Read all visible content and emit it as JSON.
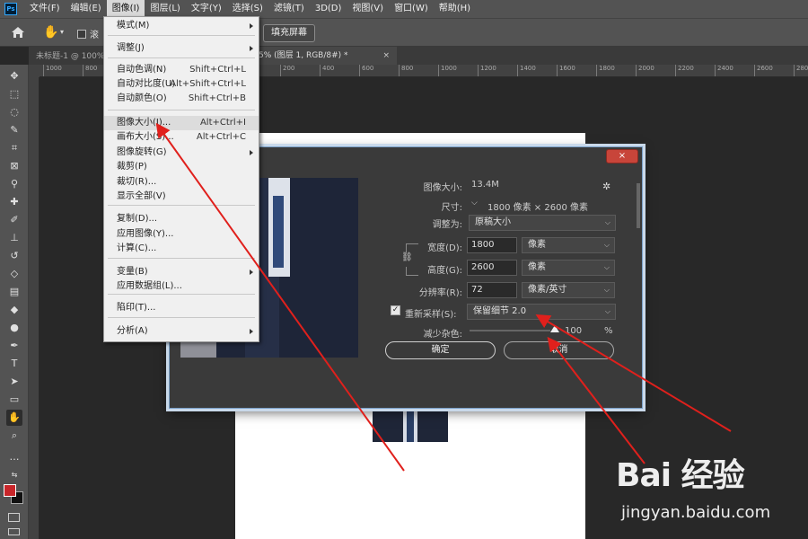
{
  "app": {
    "logo": "Ps"
  },
  "menubar": [
    {
      "label": "文件(F)"
    },
    {
      "label": "编辑(E)"
    },
    {
      "label": "图像(I)"
    },
    {
      "label": "图层(L)"
    },
    {
      "label": "文字(Y)"
    },
    {
      "label": "选择(S)"
    },
    {
      "label": "滤镜(T)"
    },
    {
      "label": "3D(D)"
    },
    {
      "label": "视图(V)"
    },
    {
      "label": "窗口(W)"
    },
    {
      "label": "帮助(H)"
    }
  ],
  "optbar": {
    "check_label": "滚",
    "fill_screen": "填充屏幕"
  },
  "tabs": {
    "doc1": "未标题-1 @ 100%",
    "doc2": "5% (图层 1, RGB/8#) *",
    "close": "×"
  },
  "ruler": [
    "1000",
    "800",
    "600",
    "400",
    "200",
    "0",
    "200",
    "400",
    "600",
    "800",
    "1000",
    "1200",
    "1400",
    "1600",
    "1800",
    "2000",
    "2200",
    "2400",
    "2600",
    "2800"
  ],
  "image_menu": {
    "items": [
      {
        "label": "模式(M)",
        "shortcut": "",
        "submenu": true
      },
      {
        "label": "调整(J)",
        "shortcut": "",
        "submenu": true
      },
      {
        "label": "自动色调(N)",
        "shortcut": "Shift+Ctrl+L",
        "submenu": false
      },
      {
        "label": "自动对比度(U)",
        "shortcut": "Alt+Shift+Ctrl+L",
        "submenu": false
      },
      {
        "label": "自动颜色(O)",
        "shortcut": "Shift+Ctrl+B",
        "submenu": false
      },
      {
        "label": "图像大小(I)...",
        "shortcut": "Alt+Ctrl+I",
        "submenu": false
      },
      {
        "label": "画布大小(S)...",
        "shortcut": "Alt+Ctrl+C",
        "submenu": false
      },
      {
        "label": "图像旋转(G)",
        "shortcut": "",
        "submenu": true
      },
      {
        "label": "裁剪(P)",
        "shortcut": "",
        "submenu": false
      },
      {
        "label": "裁切(R)...",
        "shortcut": "",
        "submenu": false
      },
      {
        "label": "显示全部(V)",
        "shortcut": "",
        "submenu": false
      },
      {
        "label": "复制(D)...",
        "shortcut": "",
        "submenu": false
      },
      {
        "label": "应用图像(Y)...",
        "shortcut": "",
        "submenu": false
      },
      {
        "label": "计算(C)...",
        "shortcut": "",
        "submenu": false
      },
      {
        "label": "变量(B)",
        "shortcut": "",
        "submenu": true
      },
      {
        "label": "应用数据组(L)...",
        "shortcut": "",
        "submenu": false
      },
      {
        "label": "陷印(T)...",
        "shortcut": "",
        "submenu": false
      },
      {
        "label": "分析(A)",
        "shortcut": "",
        "submenu": true
      }
    ]
  },
  "dialog": {
    "close": "×",
    "image_size_label": "图像大小:",
    "image_size_value": "13.4M",
    "dimensions_label": "尺寸:",
    "dimensions_value": "1800 像素 × 2600 像素",
    "fit_to_label": "调整为:",
    "fit_to_value": "原稿大小",
    "width_label": "宽度(D):",
    "width_value": "1800",
    "width_unit": "像素",
    "height_label": "高度(G):",
    "height_value": "2600",
    "height_unit": "像素",
    "resolution_label": "分辨率(R):",
    "resolution_value": "72",
    "resolution_unit": "像素/英寸",
    "resample_label": "重新采样(S):",
    "resample_checked": "✓",
    "resample_value": "保留细节 2.0",
    "noise_label": "减少杂色:",
    "noise_value": "100",
    "noise_unit": "%",
    "ok": "确定",
    "cancel": "取消"
  },
  "watermark": {
    "brand": "Bai 经验",
    "url": "jingyan.baidu.com"
  }
}
